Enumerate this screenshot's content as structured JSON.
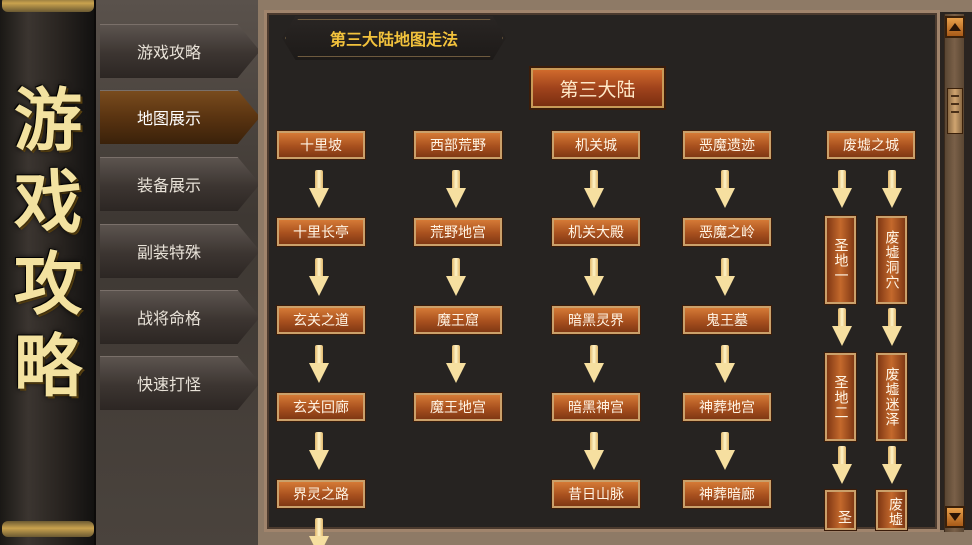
{
  "scroll_title": [
    "游",
    "戏",
    "攻",
    "略"
  ],
  "menu": {
    "items": [
      {
        "label": "游戏攻略",
        "active": false
      },
      {
        "label": "地图展示",
        "active": true
      },
      {
        "label": "装备展示",
        "active": false
      },
      {
        "label": "副装特殊",
        "active": false
      },
      {
        "label": "战将命格",
        "active": false
      },
      {
        "label": "快速打怪",
        "active": false
      }
    ]
  },
  "panel": {
    "header": "第三大陆地图走法",
    "continent": "第三大陆"
  },
  "map": {
    "col1": [
      "十里坡",
      "十里长亭",
      "玄关之道",
      "玄关回廊",
      "界灵之路"
    ],
    "col2": [
      "西部荒野",
      "荒野地宫",
      "魔王窟",
      "魔王地宫"
    ],
    "col3": [
      "机关城",
      "机关大殿",
      "暗黑灵界",
      "暗黑神宫",
      "昔日山脉"
    ],
    "col4": [
      "恶魔遗迹",
      "恶魔之岭",
      "鬼王墓",
      "神葬地宫",
      "神葬暗廊"
    ],
    "col5_top": "废墟之城",
    "col5a": [
      "圣地一",
      "圣地二",
      "圣"
    ],
    "col5b": [
      "废墟洞穴",
      "废墟迷泽",
      "废墟"
    ]
  },
  "colors": {
    "accent_gold": "#f2c23c",
    "node_orange": "#a8501e",
    "active_menu": "#5a3411"
  }
}
